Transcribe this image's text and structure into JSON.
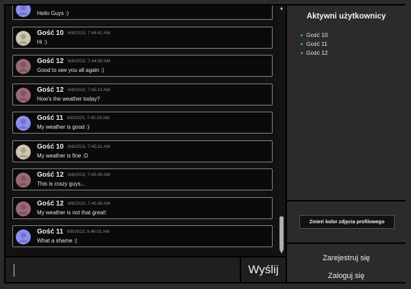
{
  "chat": {
    "messages": [
      {
        "author": "",
        "time": "",
        "text": "Hello Guys :)",
        "avatar_color": "#8e8ef0",
        "partial": true
      },
      {
        "author": "Gość 10",
        "time": "6/8/2023, 7:44:41 AM",
        "text": "Hi :)",
        "avatar_color": "#cfc6b3"
      },
      {
        "author": "Gość 12",
        "time": "6/8/2023, 7:44:58 AM",
        "text": "Good to see you all again :)",
        "avatar_color": "#9b6a74"
      },
      {
        "author": "Gość 12",
        "time": "6/8/2023, 7:45:13 AM",
        "text": "How's the weather today?",
        "avatar_color": "#9b6a74"
      },
      {
        "author": "Gość 11",
        "time": "6/8/2023, 7:45:24 AM",
        "text": "My weather is good :)",
        "avatar_color": "#8e8ef0"
      },
      {
        "author": "Gość 10",
        "time": "6/8/2023, 7:45:31 AM",
        "text": "My weather is fine :D",
        "avatar_color": "#cfc6b3"
      },
      {
        "author": "Gość 12",
        "time": "6/8/2023, 7:45:40 AM",
        "text": "This is crazy guys...",
        "avatar_color": "#9b6a74"
      },
      {
        "author": "Gość 12",
        "time": "6/8/2023, 7:45:48 AM",
        "text": "My weather is not that great!",
        "avatar_color": "#9b6a74"
      },
      {
        "author": "Gość 11",
        "time": "6/8/2023, 9:46:01 AM",
        "text": "What a shame :(",
        "avatar_color": "#8e8ef0"
      }
    ],
    "input": {
      "value": "",
      "placeholder": ""
    },
    "send_label": "Wyślij"
  },
  "users_panel": {
    "title": "Aktywni użytkownicy",
    "users": [
      "Gość 10",
      "Gość 11",
      "Gość 12"
    ],
    "bullet_color": "#4caf50"
  },
  "profile": {
    "change_color_label": "Zmień kolor zdjęcia profilowego"
  },
  "auth": {
    "register_label": "Zarejestruj się",
    "login_label": "Zaloguj się"
  }
}
